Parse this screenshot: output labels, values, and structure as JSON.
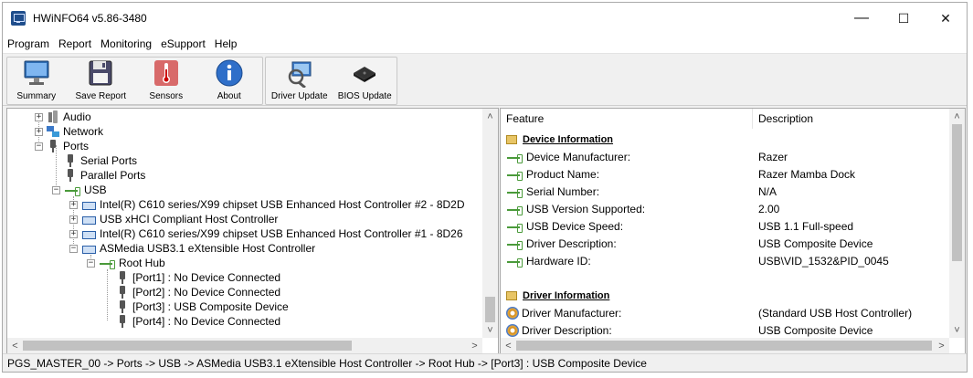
{
  "window": {
    "title": "HWiNFO64 v5.86-3480",
    "minimize": "—",
    "maximize": "☐",
    "close": "✕"
  },
  "menu": [
    "Program",
    "Report",
    "Monitoring",
    "eSupport",
    "Help"
  ],
  "toolbar": {
    "summary": "Summary",
    "save_report": "Save Report",
    "sensors": "Sensors",
    "about": "About",
    "driver_update": "Driver Update",
    "bios_update": "BIOS Update"
  },
  "tree": {
    "audio": "Audio",
    "network": "Network",
    "ports": "Ports",
    "serial_ports": "Serial Ports",
    "parallel_ports": "Parallel Ports",
    "usb": "USB",
    "controllers": [
      "Intel(R) C610 series/X99 chipset USB Enhanced Host Controller #2 - 8D2D",
      "USB xHCI Compliant Host Controller",
      "Intel(R) C610 series/X99 chipset USB Enhanced Host Controller #1 - 8D26",
      "ASMedia USB3.1 eXtensible Host Controller"
    ],
    "root_hub": "Root Hub",
    "ports_list": [
      "[Port1] : No Device Connected",
      "[Port2] : No Device Connected",
      "[Port3] : USB Composite Device",
      "[Port4] : No Device Connected"
    ]
  },
  "details": {
    "col_feature": "Feature",
    "col_description": "Description",
    "section1": "Device Information",
    "rows1": [
      {
        "feature": "Device Manufacturer:",
        "value": "Razer"
      },
      {
        "feature": "Product Name:",
        "value": "Razer Mamba Dock"
      },
      {
        "feature": "Serial Number:",
        "value": "N/A"
      },
      {
        "feature": "USB Version Supported:",
        "value": "2.00"
      },
      {
        "feature": "USB Device Speed:",
        "value": "USB 1.1 Full-speed"
      },
      {
        "feature": "Driver Description:",
        "value": "USB Composite Device"
      },
      {
        "feature": "Hardware ID:",
        "value": "USB\\VID_1532&PID_0045"
      }
    ],
    "section2": "Driver Information",
    "rows2": [
      {
        "feature": "Driver Manufacturer:",
        "value": "(Standard USB Host Controller)"
      },
      {
        "feature": "Driver Description:",
        "value": "USB Composite Device"
      }
    ]
  },
  "scroll": {
    "up": "˄",
    "down": "˅",
    "left": "<",
    "right": ">"
  },
  "status": "PGS_MASTER_00 -> Ports -> USB -> ASMedia USB3.1 eXtensible Host Controller -> Root Hub -> [Port3] : USB Composite Device",
  "colors": {
    "accent": "#1f4e8c",
    "selection": "#0078d7"
  }
}
